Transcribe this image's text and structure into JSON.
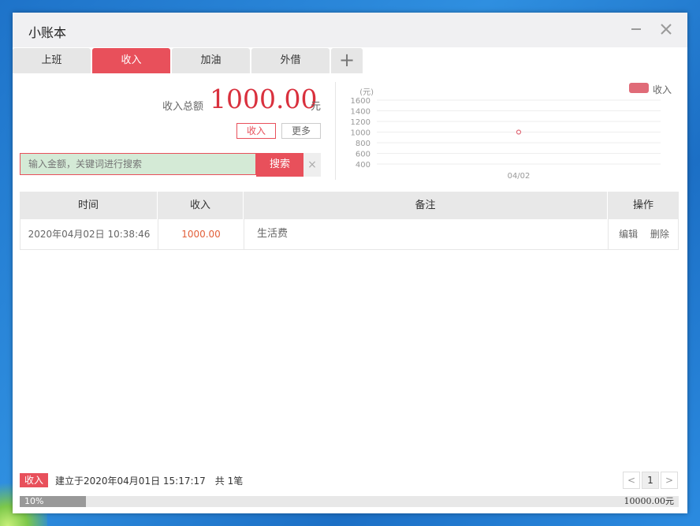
{
  "window": {
    "title": "小账本"
  },
  "tabs": [
    {
      "label": "上班",
      "active": false
    },
    {
      "label": "收入",
      "active": true
    },
    {
      "label": "加油",
      "active": false
    },
    {
      "label": "外借",
      "active": false
    }
  ],
  "summary": {
    "total_label": "收入总额",
    "total_value": "1000.00",
    "unit": "元",
    "type_button": "收入",
    "more_button": "更多"
  },
  "search": {
    "placeholder": "输入金额，关键词进行搜索",
    "button_label": "搜索",
    "clear_symbol": "×"
  },
  "chart_data": {
    "type": "line",
    "x": [
      "04/02"
    ],
    "series": [
      {
        "name": "收入",
        "values": [
          1000
        ]
      }
    ],
    "ylabel": "元",
    "yticks": [
      1600,
      1400,
      1200,
      1000,
      800,
      600,
      400
    ],
    "ylim": [
      400,
      1600
    ],
    "legend": "top-right",
    "grid": true,
    "color": "#e06b78"
  },
  "table": {
    "headers": [
      "时间",
      "收入",
      "备注",
      "操作"
    ],
    "rows": [
      {
        "time": "2020年04月02日 10:38:46",
        "amount": "1000.00",
        "note": "生活费",
        "edit": "编辑",
        "delete": "删除"
      }
    ]
  },
  "footer": {
    "badge": "收入",
    "info": "建立于2020年04月01日 15:17:17　共 1笔",
    "pager_prev": "<",
    "pager_current": "1",
    "pager_next": ">",
    "progress_percent": 10,
    "progress_label": "10%",
    "goal": "10000.00元"
  },
  "colors": {
    "accent": "#e8505b",
    "amount": "#d9303d"
  }
}
